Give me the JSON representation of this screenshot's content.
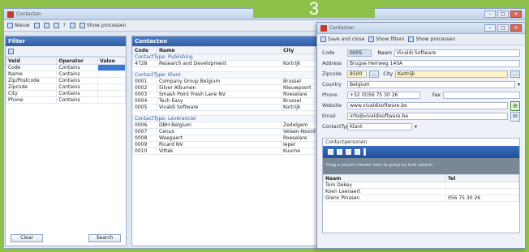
{
  "badge": "3",
  "window": {
    "title": "Contacten"
  },
  "toolbar": {
    "new_label": "Nieuw",
    "help_label": "?",
    "processes_label": "Show processen"
  },
  "filter": {
    "title": "Filter",
    "headers": [
      "Veld",
      "Operator",
      "Value"
    ],
    "rows": [
      [
        "Code",
        "Contains",
        ""
      ],
      [
        "Name",
        "Contains",
        ""
      ],
      [
        "Zip/Postcode",
        "Contains",
        ""
      ],
      [
        "Zipcode",
        "Contains",
        ""
      ],
      [
        "City",
        "Contains",
        ""
      ],
      [
        "Phone",
        "Contains",
        ""
      ]
    ],
    "clear_label": "Clear",
    "search_label": "Search"
  },
  "contacts": {
    "title": "Contacten",
    "headers": [
      "Code",
      "Name",
      "City"
    ],
    "groups": [
      {
        "label": "ContactType: Publishing",
        "rows": [
          [
            "4728",
            "Research and Development",
            "Kortrijk"
          ]
        ]
      },
      {
        "label": "ContactType: Klant",
        "rows": [
          [
            "0001",
            "Company Group Belgium",
            "Brussel"
          ],
          [
            "0002",
            "Silver Albumen",
            "Nieuwpoort"
          ],
          [
            "0003",
            "Smash Point Fresh Lane NV",
            "Roeselare"
          ],
          [
            "0004",
            "Tech Easy",
            "Brussel"
          ],
          [
            "0005",
            "Vivaldi Software",
            "Kortrijk"
          ]
        ]
      },
      {
        "label": "ContactType: Leverancier",
        "rows": [
          [
            "0006",
            "DBH Belgium",
            "Zedelgem"
          ],
          [
            "0007",
            "Cenus",
            "Velsen-Noord"
          ],
          [
            "0008",
            "Waegaert",
            "Roeselare"
          ],
          [
            "0009",
            "Ricard NV",
            "Ieper"
          ],
          [
            "0010",
            "Vittek",
            "Kuurne"
          ]
        ]
      }
    ]
  },
  "editor": {
    "title": "Contacten",
    "save_close_label": "Save and close",
    "show_filters_label": "Show filters",
    "show_processes_label": "Show processen",
    "fields": {
      "code_label": "Code",
      "code_value": "0005",
      "name_label": "Naam",
      "name_value": "Vivaldi Software",
      "address_label": "Address",
      "address_value": "Brugse Heirweg 140A",
      "zipcode_label": "Zipcode",
      "zipcode_value": "8500",
      "city_label": "City",
      "city_value": "Kortrijk",
      "country_label": "Country",
      "country_value": "Belgium",
      "phone_label": "Phone",
      "phone_value": "+32 (0)56 75 30 26",
      "fax_label": "Fax",
      "fax_value": "",
      "website_label": "Website",
      "website_value": "www.vivaldisoftware.be",
      "email_label": "Email",
      "email_value": "info@vivaldisoftware.be",
      "contacttype_label": "ContactType",
      "contacttype_value": "Klant"
    },
    "contactpersonen": {
      "title": "Contactpersonen",
      "drop_text": "Drag a column header here to group by that column",
      "headers": [
        "Naam",
        "Tel"
      ],
      "rows": [
        [
          "Tom Dekey",
          ""
        ],
        [
          "Koen Leenaert",
          ""
        ],
        [
          "Glenn Pinssen",
          "056 75 30 26"
        ]
      ]
    }
  }
}
